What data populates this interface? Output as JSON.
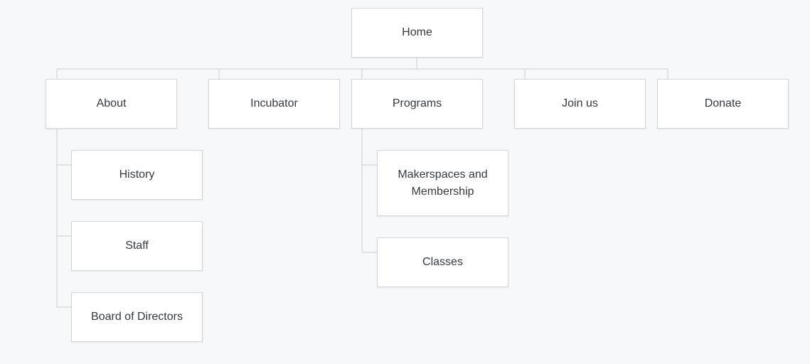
{
  "sitemap": {
    "home": "Home",
    "about": "About",
    "incubator": "Incubator",
    "programs": "Programs",
    "join_us": "Join us",
    "donate": "Donate",
    "about_children": {
      "history": "History",
      "staff": "Staff",
      "board": "Board of Directors"
    },
    "programs_children": {
      "makerspaces": "Makerspaces and Membership",
      "classes": "Classes"
    }
  },
  "colors": {
    "background": "#f7f8fa",
    "node_fill": "#ffffff",
    "node_border": "#d3d6db",
    "connector": "#c9ccd1",
    "text": "#333a40"
  }
}
